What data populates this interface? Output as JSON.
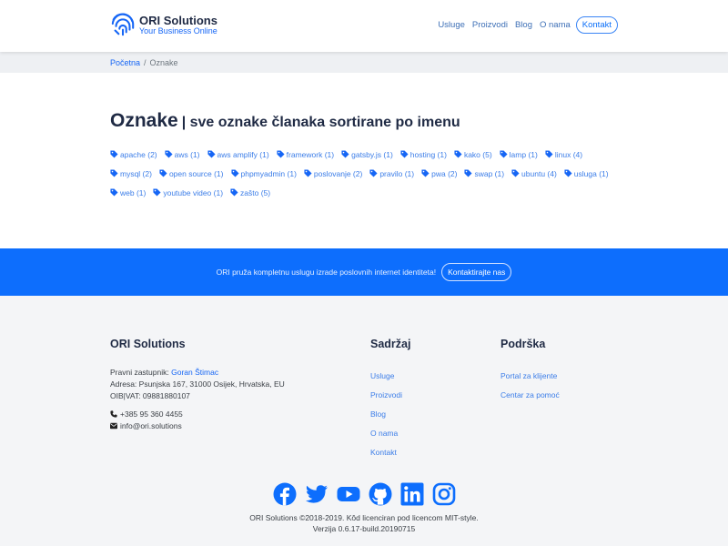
{
  "brand": {
    "name": "ORI Solutions",
    "tagline": "Your Business Online",
    "accent": "#0d6efd"
  },
  "nav": {
    "links": [
      "Usluge",
      "Proizvodi",
      "Blog",
      "O nama"
    ],
    "contact": "Kontakt"
  },
  "breadcrumb": {
    "home": "Početna",
    "separator": "/",
    "current": "Oznake"
  },
  "page": {
    "title": "Oznake",
    "subtitle": "| sve oznake članaka sortirane po imenu"
  },
  "tags": [
    "apache (2)",
    "aws (1)",
    "aws amplify (1)",
    "framework (1)",
    "gatsby.js (1)",
    "hosting (1)",
    "kako (5)",
    "lamp (1)",
    "linux (4)",
    "mysql (2)",
    "open source (1)",
    "phpmyadmin (1)",
    "poslovanje (2)",
    "pravilo (1)",
    "pwa (2)",
    "swap (1)",
    "ubuntu (4)",
    "usluga (1)",
    "web (1)",
    "youtube video (1)",
    "zašto (5)"
  ],
  "cta": {
    "text": "ORI pruža kompletnu uslugu izrade poslovnih internet identiteta!",
    "button": "Kontaktirajte nas"
  },
  "footer": {
    "company": {
      "title": "ORI Solutions",
      "rep_label": "Pravni zastupnik:",
      "rep_name": "Goran Štimac",
      "address": "Adresa: Psunjska 167, 31000 Osijek, Hrvatska, EU",
      "oib": "OIB|VAT: 09881880107",
      "phone": "+385 95 360 4455",
      "email": "info@ori.solutions"
    },
    "content": {
      "title": "Sadržaj",
      "links": [
        "Usluge",
        "Proizvodi",
        "Blog",
        "O nama",
        "Kontakt"
      ]
    },
    "support": {
      "title": "Podrška",
      "links": [
        "Portal za klijente",
        "Centar za pomoć"
      ]
    },
    "social": [
      "facebook-icon",
      "twitter-icon",
      "youtube-icon",
      "github-icon",
      "linkedin-icon",
      "instagram-icon"
    ],
    "copyright": "ORI Solutions ©2018-2019. Kôd licenciran pod licencom MIT-style.",
    "version": "Verzija 0.6.17-build.20190715"
  }
}
